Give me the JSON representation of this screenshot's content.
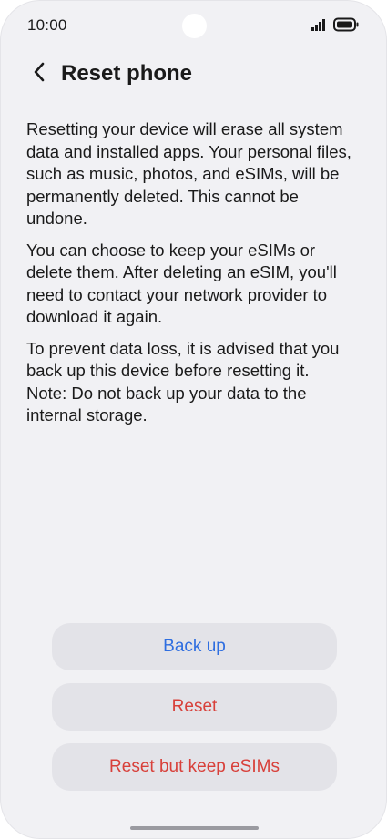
{
  "status_bar": {
    "time": "10:00",
    "icons": [
      "signal-icon",
      "battery-icon"
    ]
  },
  "header": {
    "title": "Reset phone"
  },
  "body": {
    "paragraph1": "Resetting your device will erase all system data and installed apps. Your personal files, such as music, photos, and eSIMs, will be permanently deleted. This cannot be undone.",
    "paragraph2": "You can choose to keep your eSIMs or delete them. After deleting an eSIM, you'll need to contact your network provider to download it again.",
    "paragraph3": "To prevent data loss, it is advised that you back up this device before resetting it.",
    "note": "Note: Do not back up your data to the internal storage."
  },
  "actions": {
    "backup_label": "Back up",
    "reset_label": "Reset",
    "reset_keep_label": "Reset but keep eSIMs"
  },
  "colors": {
    "background": "#f1f1f4",
    "button_bg": "#e3e3e8",
    "primary_blue": "#2f6ee0",
    "destructive_red": "#d8403a"
  }
}
